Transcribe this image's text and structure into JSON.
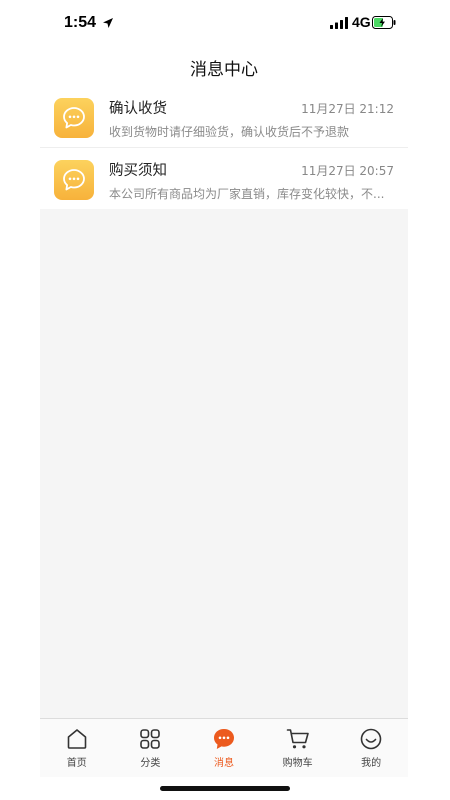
{
  "status_bar": {
    "time": "1:54",
    "network": "4G"
  },
  "header": {
    "title": "消息中心"
  },
  "messages": [
    {
      "title": "确认收货",
      "time": "11月27日 21:12",
      "preview": "收到货物时请仔细验货，确认收货后不予退款",
      "icon": "chat-bubble-icon"
    },
    {
      "title": "购买须知",
      "time": "11月27日 20:57",
      "preview": "本公司所有商品均为厂家直销，库存变化较快，不...",
      "icon": "chat-bubble-icon"
    }
  ],
  "tab_bar": {
    "tabs": [
      {
        "label": "首页",
        "icon": "home-icon",
        "active": false
      },
      {
        "label": "分类",
        "icon": "grid-icon",
        "active": false
      },
      {
        "label": "消息",
        "icon": "message-icon",
        "active": true
      },
      {
        "label": "购物车",
        "icon": "cart-icon",
        "active": false
      },
      {
        "label": "我的",
        "icon": "smiley-icon",
        "active": false
      }
    ]
  },
  "colors": {
    "accent": "#ec5a1e",
    "icon_gradient_top": "#fcd25d",
    "icon_gradient_bottom": "#f7b23b",
    "content_background": "#f5f5f5"
  }
}
